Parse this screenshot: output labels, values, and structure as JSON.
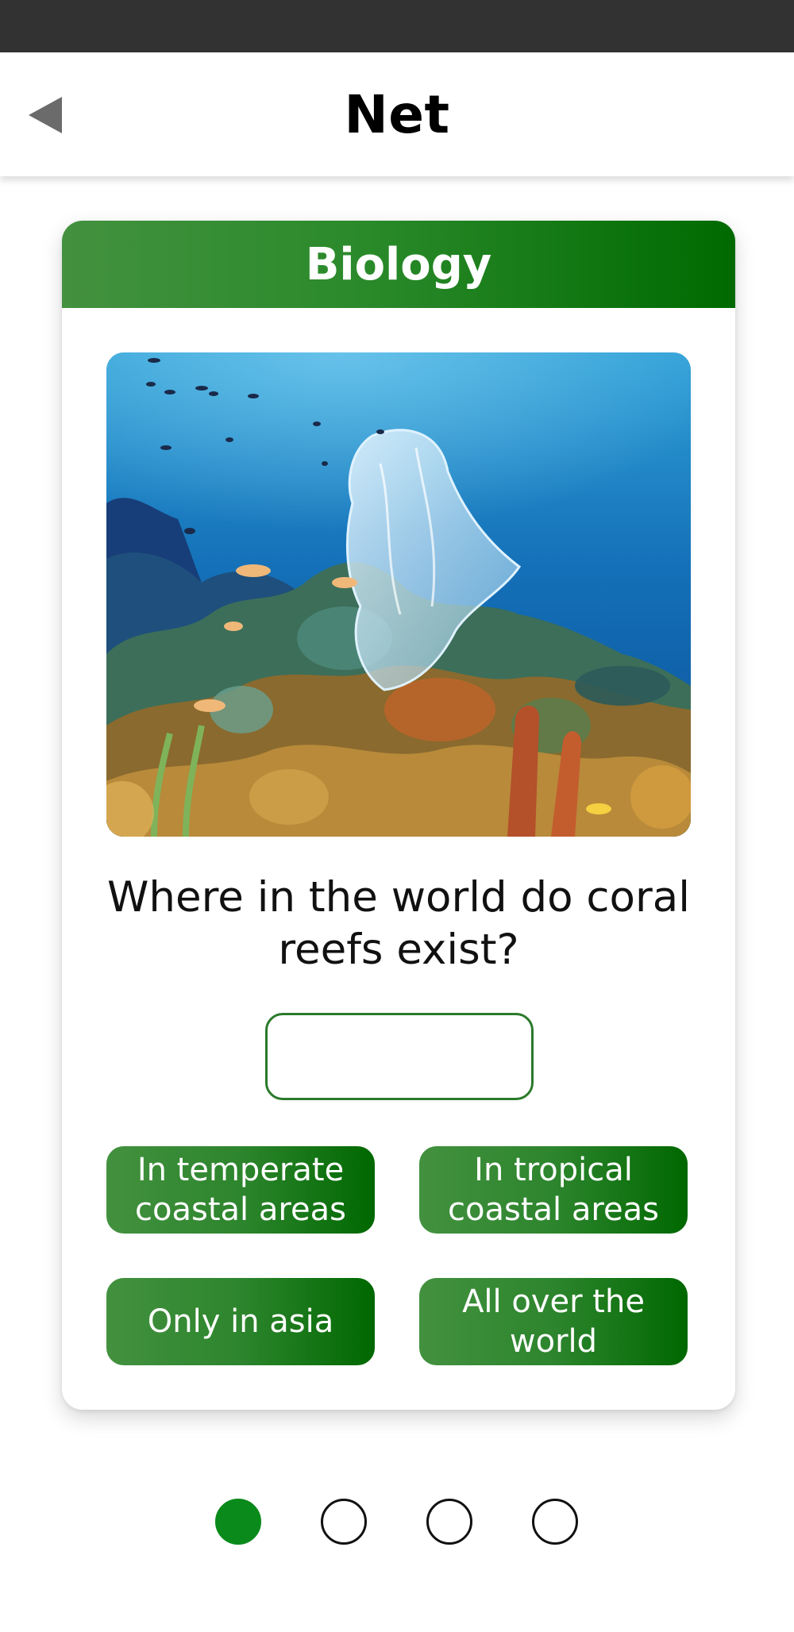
{
  "app_bar": {
    "title": "Net",
    "back_icon": "back-arrow-icon"
  },
  "card": {
    "subject": "Biology",
    "image_icon": "coral-reef-plastic-bag-photo",
    "question": "Where in the world do coral reefs exist?",
    "answer": {
      "value": "",
      "placeholder": ""
    },
    "options": [
      {
        "label": "In temperate coastal areas"
      },
      {
        "label": "In tropical coastal areas"
      },
      {
        "label": "Only in asia"
      },
      {
        "label": "All over the world"
      }
    ]
  },
  "pagination": {
    "current": 1,
    "total": 4
  },
  "colors": {
    "accent_start": "#43913f",
    "accent_end": "#006a00",
    "active_dot": "#0a8a1a",
    "status_bar": "#323232"
  }
}
